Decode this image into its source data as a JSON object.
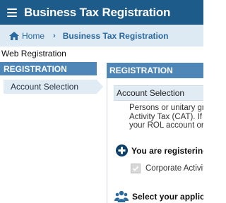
{
  "app": {
    "title": "Business Tax Registration"
  },
  "breadcrumb": {
    "home": "Home",
    "separator": "›",
    "current": "Business Tax Registration"
  },
  "section": {
    "label": "Web Registration"
  },
  "sidebar": {
    "header": "REGISTRATION",
    "items": [
      {
        "label": "Account Selection"
      }
    ]
  },
  "main": {
    "header": "REGISTRATION",
    "subheader": "Account Selection",
    "description": [
      "Persons or unitary gr",
      "Activity Tax (CAT). If y",
      "your ROL account or"
    ],
    "registering": {
      "label": "You are registering"
    },
    "checkbox": {
      "label": "Corporate Activity",
      "checked": true
    },
    "applicant": {
      "label": "Select your applican"
    }
  },
  "colors": {
    "topbar": "#1c5b8a",
    "crumbbar": "#dde9f3",
    "panel_header": "#4e86b8",
    "selected_item": "#e1ebf4",
    "icon_dark": "#0d3f6b"
  }
}
